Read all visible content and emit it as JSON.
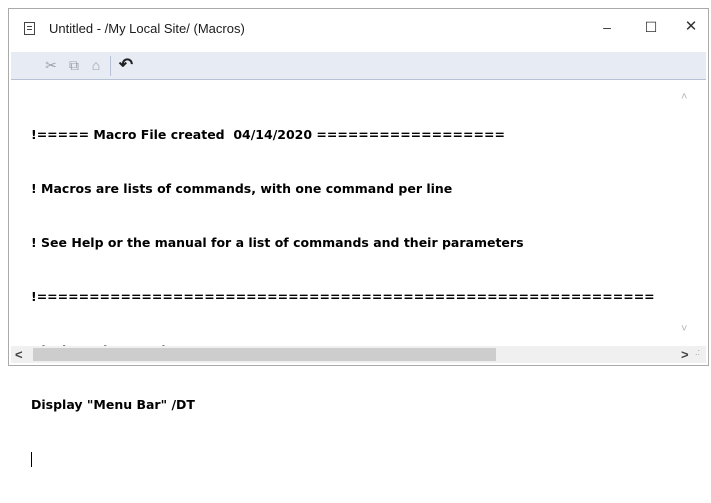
{
  "window": {
    "title": "Untitled - /My Local Site/ (Macros)",
    "controls": {
      "minimize": "–",
      "maximize": "☐",
      "close": "✕"
    }
  },
  "toolbar": {
    "cut_icon": "✂",
    "copy_icon": "⧉",
    "paste_icon": "⌂",
    "undo_icon": "↶"
  },
  "editor": {
    "lines": [
      "!===== Macro File created  04/14/2020 ==================",
      "! Macros are lists of commands, with one command per line",
      "! See Help or the manual for a list of commands and their parameters",
      "!===========================================================",
      "Display \"Alarm and Event Banner\" /DB",
      "Display \"Menu Bar\" /DT"
    ]
  },
  "scrollbars": {
    "up": "˄",
    "down": "˅",
    "left": "<",
    "right": ">"
  }
}
